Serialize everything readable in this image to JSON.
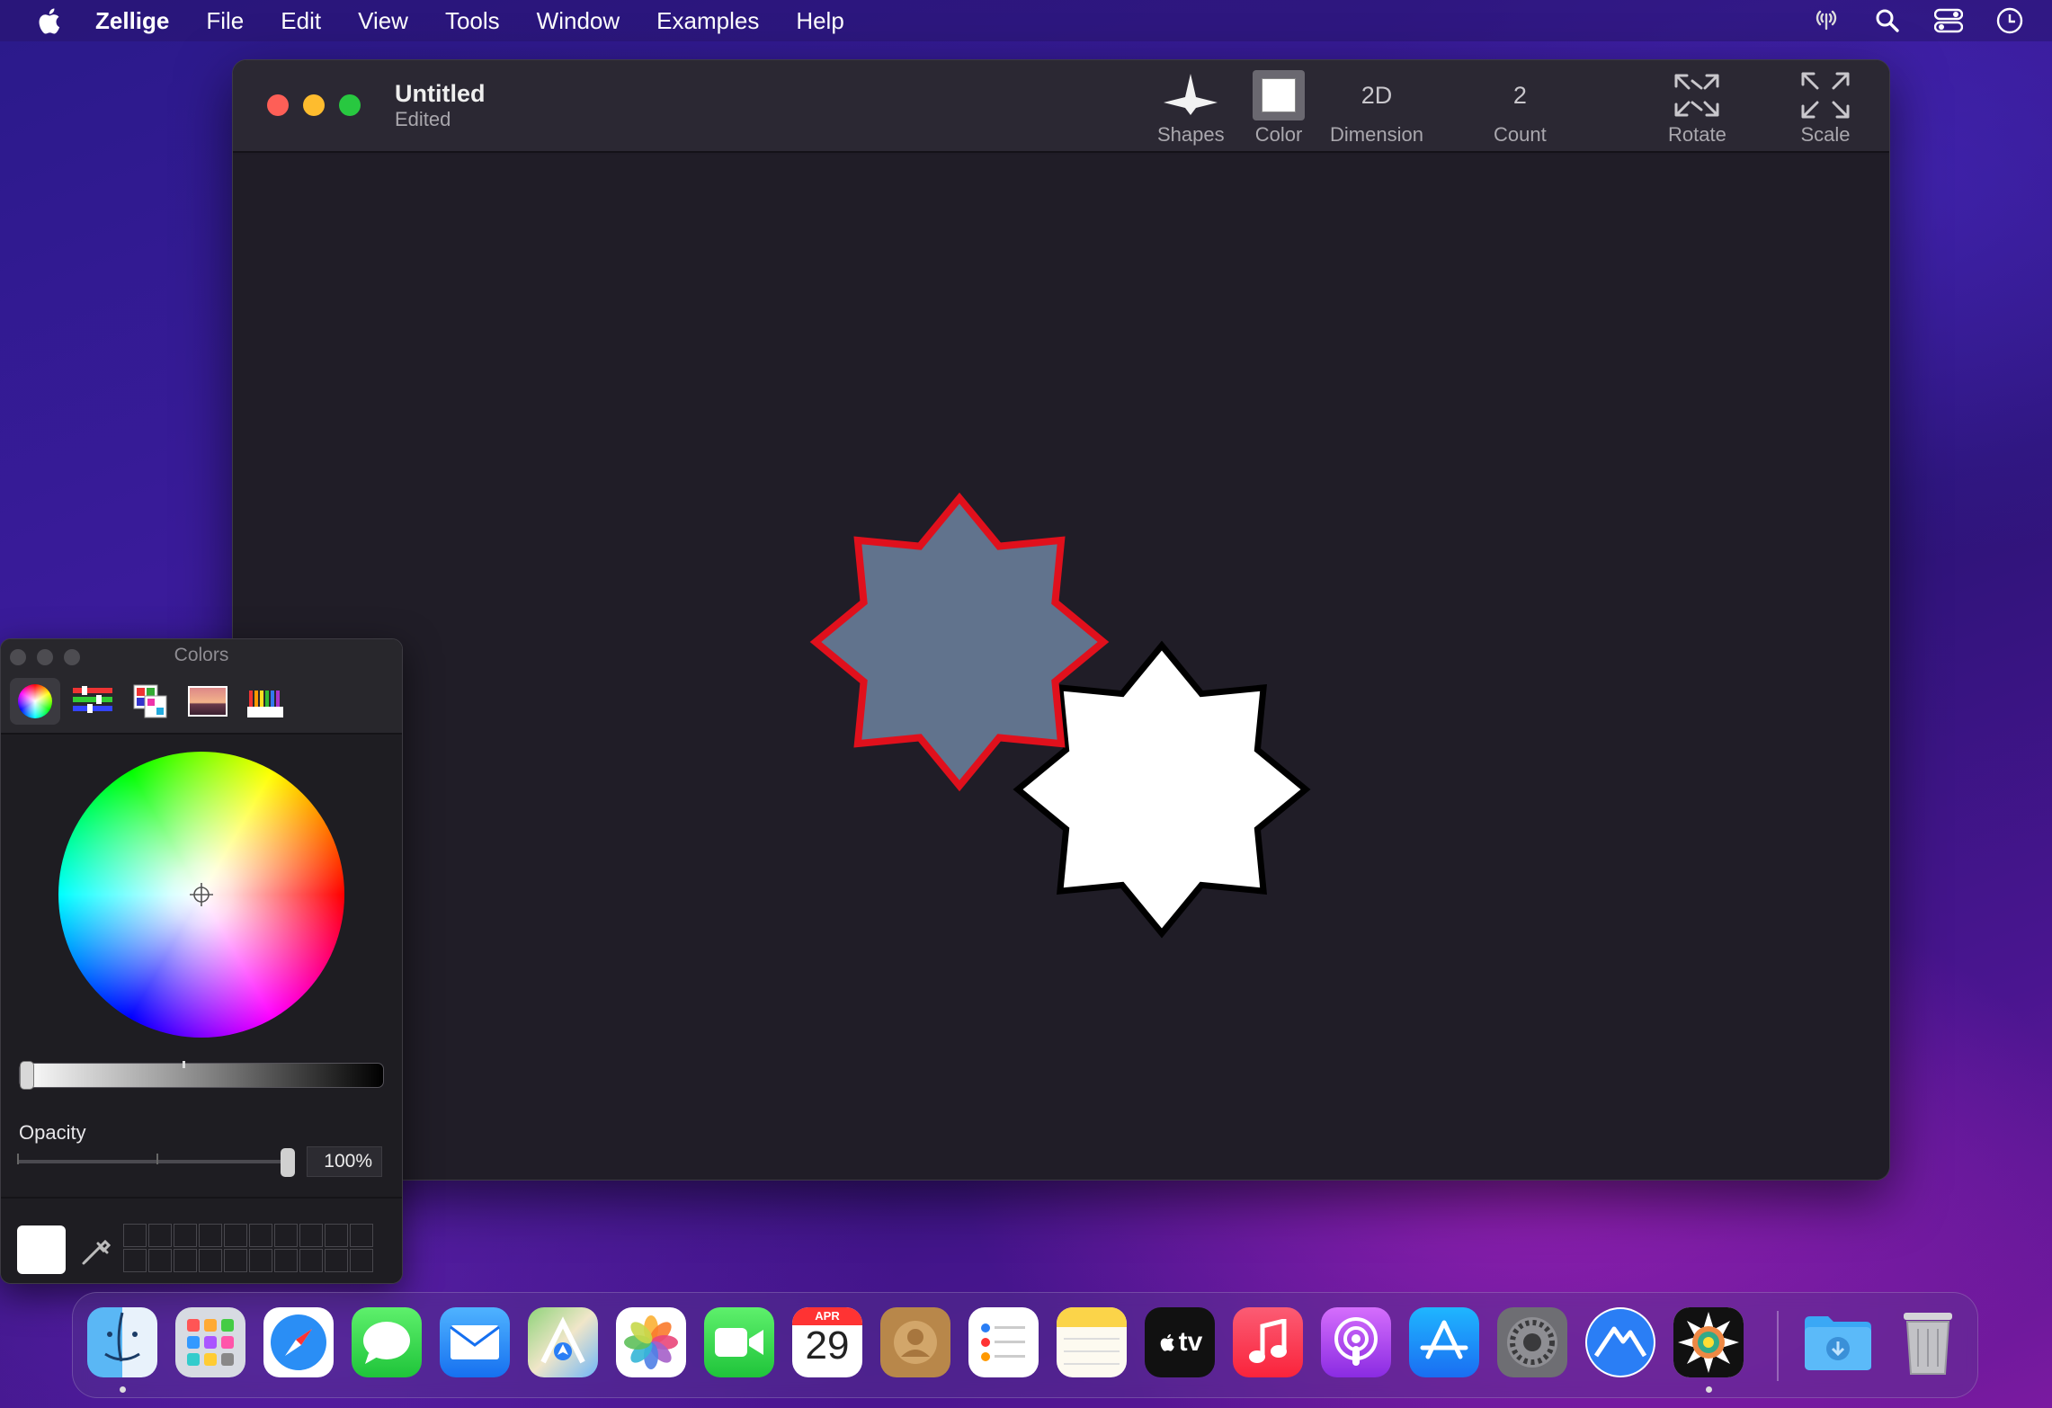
{
  "menubar": {
    "app_name": "Zellige",
    "items": [
      "File",
      "Edit",
      "View",
      "Tools",
      "Window",
      "Examples",
      "Help"
    ],
    "status_icons": [
      "antenna-icon",
      "search-icon",
      "control-center-icon",
      "siri-icon"
    ]
  },
  "window": {
    "title": "Untitled",
    "subtitle": "Edited",
    "toolbar": {
      "shapes_label": "Shapes",
      "color_label": "Color",
      "dimension_value": "2D",
      "dimension_label": "Dimension",
      "count_value": "2",
      "count_label": "Count",
      "rotate_label": "Rotate",
      "scale_label": "Scale"
    },
    "canvas": {
      "shapes": [
        {
          "name": "eight-point-star",
          "fill": "#61738d",
          "stroke": "#e0101c"
        },
        {
          "name": "eight-point-star",
          "fill": "#ffffff",
          "stroke": "#000000"
        }
      ]
    }
  },
  "colors_panel": {
    "title": "Colors",
    "modes": [
      "color-wheel-icon",
      "sliders-icon",
      "palettes-icon",
      "image-palettes-icon",
      "pencils-icon"
    ],
    "active_mode": "color-wheel-icon",
    "opacity_label": "Opacity",
    "opacity_value": "100%",
    "current_color": "#ffffff"
  },
  "dock": {
    "apps": [
      "finder-icon",
      "launchpad-icon",
      "safari-icon",
      "messages-icon",
      "mail-icon",
      "maps-icon",
      "photos-icon",
      "facetime-icon",
      "calendar-icon",
      "contacts-icon",
      "reminders-icon",
      "notes-icon",
      "apple-tv-icon",
      "music-icon",
      "podcasts-icon",
      "app-store-icon",
      "system-settings-icon",
      "altitude-icon",
      "zellige-icon",
      "downloads-folder-icon",
      "trash-icon"
    ],
    "calendar_month": "APR",
    "calendar_day": "29",
    "tv_text": "tv"
  }
}
